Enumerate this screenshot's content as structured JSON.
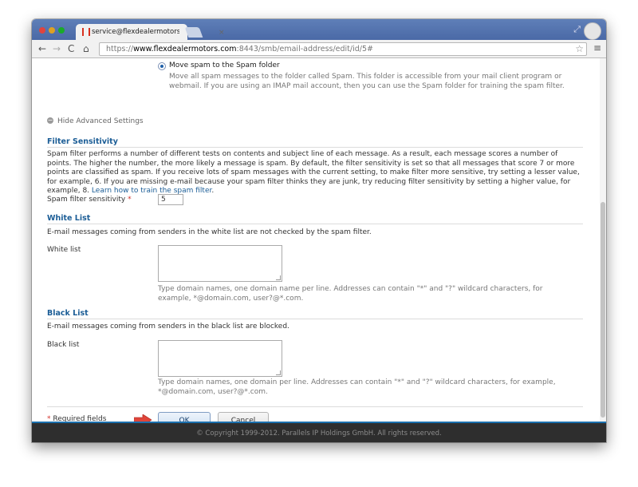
{
  "browser": {
    "tab_title": "service@flexdealermotors",
    "tab_close": "×",
    "url_scheme": "https://",
    "url_host": "www.flexdealermotors.com",
    "url_rest": ":8443/smb/email-address/edit/id/5#",
    "back": "←",
    "forward": "→",
    "reload": "C",
    "home": "⌂",
    "star": "☆",
    "menu": "≡",
    "resize": "⤢"
  },
  "spam_action": {
    "label": "Move spam to the Spam folder",
    "description": "Move all spam messages to the folder called Spam. This folder is accessible from your mail client program or webmail. If you are using an IMAP mail account, then you can use the Spam folder for training the spam filter."
  },
  "advanced": {
    "icon": "−",
    "label": "Hide Advanced Settings"
  },
  "filter": {
    "title": "Filter Sensitivity",
    "description": "Spam filter performs a number of different tests on contents and subject line of each message. As a result, each message scores a number of points. The higher the number, the more likely a message is spam. By default, the filter sensitivity is set so that all messages that score 7 or more points are classified as spam. If you receive lots of spam messages with the current setting, to make filter more sensitive, try setting a lesser value, for example, 6. If you are missing e-mail because your spam filter thinks they are junk, try reducing filter sensitivity by setting a higher value, for example, 8. ",
    "link": "Learn how to train the spam filter",
    "link_suffix": ".",
    "sensitivity_label": "Spam filter sensitivity",
    "required_mark": "*",
    "sensitivity_value": "5"
  },
  "white": {
    "title": "White List",
    "description": "E-mail messages coming from senders in the white list are not checked by the spam filter.",
    "label": "White list",
    "hint": "Type domain names, one domain name per line. Addresses can contain \"*\" and \"?\" wildcard characters, for example, *@domain.com, user?@*.com."
  },
  "black": {
    "title": "Black List",
    "description": "E-mail messages coming from senders in the black list are blocked.",
    "label": "Black list",
    "hint": "Type domain names, one domain per line. Addresses can contain \"*\" and \"?\" wildcard characters, for example, *@domain.com, user?@*.com."
  },
  "form": {
    "required_mark": "*",
    "required_text": " Required fields",
    "ok": "OK",
    "cancel": "Cancel"
  },
  "footer": {
    "copyright": "© Copyright 1999-2012. Parallels IP Holdings GmbH. All rights reserved."
  },
  "colors": {
    "accent": "#1b5d96",
    "required": "#d3302a",
    "arrow": "#e0453a"
  }
}
